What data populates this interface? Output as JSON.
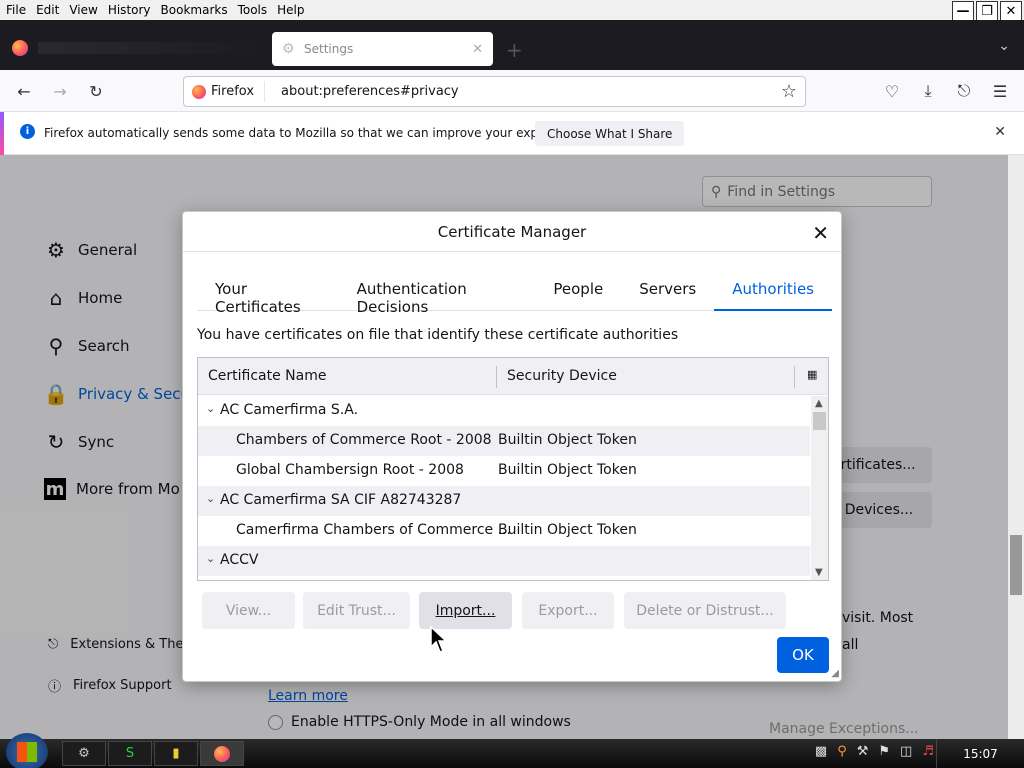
{
  "menubar": {
    "items": [
      "File",
      "Edit",
      "View",
      "History",
      "Bookmarks",
      "Tools",
      "Help"
    ]
  },
  "tabs": {
    "active_tab_label": "Settings"
  },
  "navbar": {
    "identity_label": "Firefox",
    "url": "about:preferences#privacy"
  },
  "notification": {
    "message": "Firefox automatically sends some data to Mozilla so that we can improve your experience.",
    "button": "Choose What I Share"
  },
  "settings": {
    "search_placeholder": "Find in Settings",
    "nav": [
      "General",
      "Home",
      "Search",
      "Privacy & Secu",
      "Sync",
      "More from Mo"
    ],
    "footer": [
      "Extensions & The",
      "Firefox Support"
    ],
    "view_certs_btn": "ertificates...",
    "security_devices_btn": "y Devices...",
    "text_visit": "visit. Most",
    "text_all": "all",
    "learn_more": "Learn more",
    "https_only": "Enable HTTPS-Only Mode in all windows",
    "manage_exceptions": "Manage Exceptions..."
  },
  "dialog": {
    "title": "Certificate Manager",
    "tabs": [
      "Your Certificates",
      "Authentication Decisions",
      "People",
      "Servers",
      "Authorities"
    ],
    "active_tab": "Authorities",
    "description": "You have certificates on file that identify these certificate authorities",
    "columns": [
      "Certificate Name",
      "Security Device"
    ],
    "rows": [
      {
        "type": "group",
        "name": "AC Camerfirma S.A.",
        "device": ""
      },
      {
        "type": "item",
        "name": "Chambers of Commerce Root - 2008",
        "device": "Builtin Object Token"
      },
      {
        "type": "item",
        "name": "Global Chambersign Root - 2008",
        "device": "Builtin Object Token"
      },
      {
        "type": "group",
        "name": "AC Camerfirma SA CIF A82743287",
        "device": ""
      },
      {
        "type": "item",
        "name": "Camerfirma Chambers of Commerce ...",
        "device": "Builtin Object Token"
      },
      {
        "type": "group",
        "name": "ACCV",
        "device": ""
      }
    ],
    "buttons": {
      "view": "View...",
      "edit_trust": "Edit Trust...",
      "import": "Import...",
      "export": "Export...",
      "delete": "Delete or Distrust..."
    },
    "ok": "OK"
  },
  "taskbar": {
    "clock": "15:07"
  }
}
